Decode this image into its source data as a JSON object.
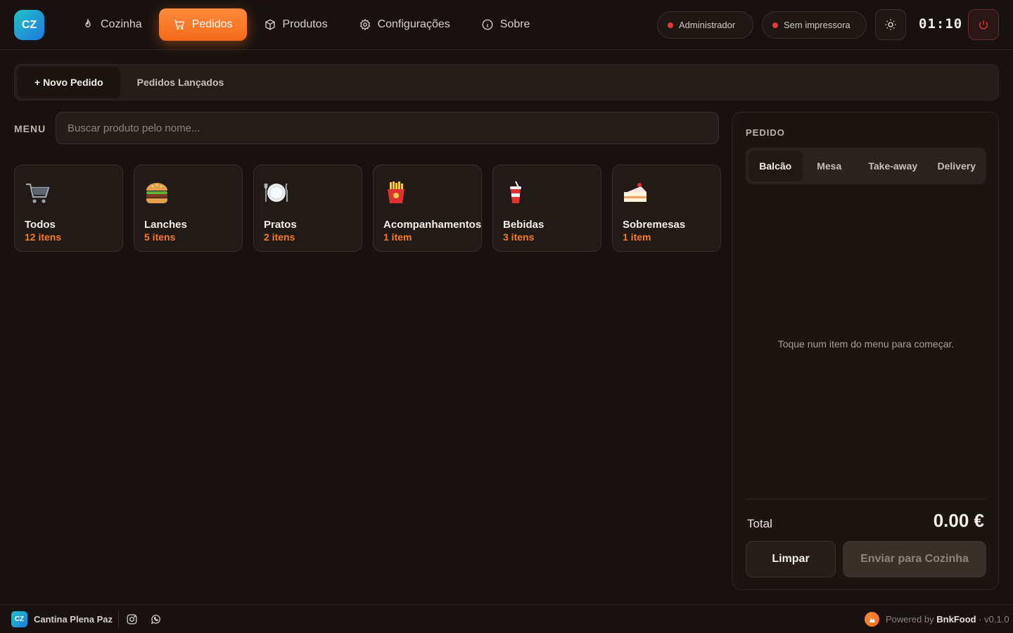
{
  "brand": {
    "initials": "CZ",
    "name": "Cantina Plena Paz"
  },
  "nav": [
    {
      "label": "Cozinha",
      "icon": "flame-icon",
      "active": false
    },
    {
      "label": "Pedidos",
      "icon": "cart-icon",
      "active": true
    },
    {
      "label": "Produtos",
      "icon": "box-icon",
      "active": false
    },
    {
      "label": "Configurações",
      "icon": "gear-icon",
      "active": false
    },
    {
      "label": "Sobre",
      "icon": "info-icon",
      "active": false
    }
  ],
  "header": {
    "user_status": "Administrador",
    "printer_status": "Sem impressora",
    "status_color": "#e5393b",
    "clock": "01:10"
  },
  "subtabs": [
    {
      "label": "+ Novo Pedido",
      "active": true
    },
    {
      "label": "Pedidos Lançados",
      "active": false
    }
  ],
  "menu": {
    "label": "MENU",
    "search_placeholder": "Buscar produto pelo nome...",
    "categories": [
      {
        "name": "Todos",
        "count": "12 itens",
        "icon": "🛒"
      },
      {
        "name": "Lanches",
        "count": "5 itens",
        "icon": "🍔"
      },
      {
        "name": "Pratos",
        "count": "2 itens",
        "icon": "🍽"
      },
      {
        "name": "Acompanhamentos",
        "count": "1 item",
        "icon": "🍟"
      },
      {
        "name": "Bebidas",
        "count": "3 itens",
        "icon": "🥤"
      },
      {
        "name": "Sobremesas",
        "count": "1 item",
        "icon": "🍰"
      }
    ]
  },
  "order": {
    "title": "PEDIDO",
    "types": [
      {
        "label": "Balcão",
        "active": true
      },
      {
        "label": "Mesa",
        "active": false
      },
      {
        "label": "Take-away",
        "active": false
      },
      {
        "label": "Delivery",
        "active": false
      }
    ],
    "empty_message": "Toque num item do menu para começar.",
    "total_label": "Total",
    "total_value": "0.00 €",
    "clear_label": "Limpar",
    "send_label": "Enviar para Cozinha"
  },
  "footer": {
    "powered_prefix": "Powered by",
    "powered_brand": "BnkFood",
    "version": "· v0.1.0"
  },
  "colors": {
    "accent": "#f56a1a",
    "background": "#171210",
    "count": "#f57c2a"
  }
}
